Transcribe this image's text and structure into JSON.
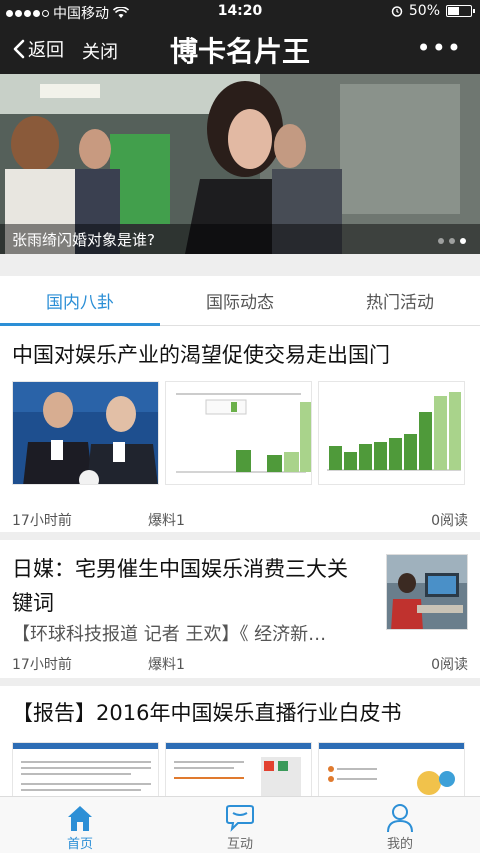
{
  "status_bar": {
    "carrier": "中国移动",
    "time": "14:20",
    "battery": "50%",
    "battery_level": 0.5
  },
  "nav": {
    "back_label": "返回",
    "close_label": "关闭",
    "title": "博卡名片王",
    "more_label": "•••"
  },
  "banner": {
    "caption": "张雨绮闪婚对象是谁?",
    "page_count": 3,
    "active_page": 3
  },
  "tabs": [
    {
      "label": "国内八卦",
      "active": true
    },
    {
      "label": "国际动态",
      "active": false
    },
    {
      "label": "热门活动",
      "active": false
    }
  ],
  "articles": [
    {
      "title": "中国对娱乐产业的渴望促使交易走出国门",
      "time": "17小时前",
      "source": "爆料1",
      "reads": "0阅读"
    },
    {
      "title_line1": "日媒：宅男催生中国娱乐消费三大关",
      "title_line2": "键词",
      "summary": "【环球科技报道 记者 王欢】《 经济新…",
      "time": "17小时前",
      "source": "爆料1",
      "reads": "0阅读"
    },
    {
      "title": "【报告】2016年中国娱乐直播行业白皮书"
    }
  ],
  "bottom_tabs": [
    {
      "label": "首页",
      "icon": "home-icon",
      "active": true
    },
    {
      "label": "互动",
      "icon": "chat-bubble-icon",
      "active": false
    },
    {
      "label": "我的",
      "icon": "person-icon",
      "active": false
    }
  ],
  "colors": {
    "accent": "#2c8fd6",
    "navbar": "#1f1f1f"
  }
}
